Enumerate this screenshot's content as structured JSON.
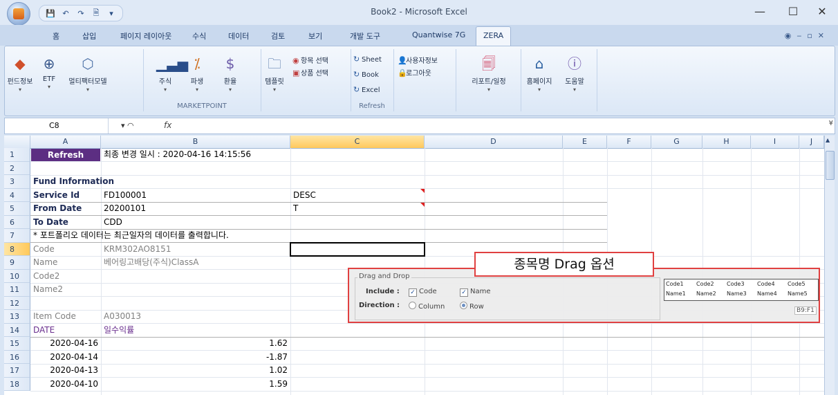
{
  "window": {
    "title": "Book2 - Microsoft Excel",
    "minimize": "—",
    "maximize": "☐",
    "close": "✕"
  },
  "ribbon_tabs": [
    "홈",
    "삽입",
    "페이지 레이아웃",
    "수식",
    "데이터",
    "검토",
    "보기",
    "개발 도구",
    "Quantwise 7G",
    "ZERA"
  ],
  "active_tab": "ZERA",
  "ribbon": {
    "buttons": [
      "펀드정보",
      "ETF",
      "멀티팩터모델",
      "주식",
      "파생",
      "환율",
      "템플릿",
      "리포트/일정",
      "홈페이지",
      "도움말"
    ],
    "small": [
      "항목 선택",
      "상품 선택",
      "Sheet",
      "Book",
      "Excel",
      "사용자정보",
      "로그아웃"
    ],
    "groups": [
      "MARKETPOINT",
      "Refresh"
    ]
  },
  "formula_bar": {
    "name_box": "C8",
    "fx": "fx",
    "value": ""
  },
  "columns": [
    "A",
    "B",
    "C",
    "D",
    "E",
    "F",
    "G",
    "H",
    "I",
    "J"
  ],
  "rows": [
    "1",
    "2",
    "3",
    "4",
    "5",
    "6",
    "7",
    "8",
    "9",
    "10",
    "11",
    "12",
    "13",
    "14",
    "15",
    "16",
    "17",
    "18"
  ],
  "cells": {
    "r1_refresh": "Refresh",
    "r1_changed": "최종 변경 일시 : 2020-04-16 14:15:56",
    "r3_a": "Fund Information",
    "r4_a": "Service Id",
    "r4_b": "FD100001",
    "r4_c": "DESC",
    "r5_a": "From Date",
    "r5_b": "20200101",
    "r5_c": "T",
    "r6_a": "To Date",
    "r6_b": "CDD",
    "r7_a": "* 포트폴리오 데이터는 최근일자의 데이터를 출력합니다.",
    "r8_a": "Code",
    "r8_b": "KRM302AO8151",
    "r9_a": "Name",
    "r9_b": "베어링고배당(주식)ClassA",
    "r10_a": "Code2",
    "r11_a": "Name2",
    "r13_a": "Item Code",
    "r13_b": "A030013",
    "r14_a": "DATE",
    "r14_b": "일수익률",
    "r15_a": "2020-04-16",
    "r15_b": "1.62",
    "r16_a": "2020-04-14",
    "r16_b": "-1.87",
    "r17_a": "2020-04-13",
    "r17_b": "1.02",
    "r18_a": "2020-04-10",
    "r18_b": "1.59"
  },
  "drag_panel": {
    "label": "종목명 Drag 옵션",
    "title": "Drag and Drop",
    "include_label": "Include :",
    "include_code": "Code",
    "include_name": "Name",
    "direction_label": "Direction :",
    "direction_column": "Column",
    "direction_row": "Row",
    "selected_direction": "Row",
    "preview": {
      "codes": [
        "Code1",
        "Code2",
        "Code3",
        "Code4",
        "Code5"
      ],
      "names": [
        "Name1",
        "Name2",
        "Name3",
        "Name4",
        "Name5"
      ],
      "range": "B9:F1"
    }
  },
  "colors": {
    "refresh_bg": "#5c2e82",
    "highlight": "#e04040",
    "header_text": "#1d2a55",
    "purple_text": "#6a2f8e"
  }
}
